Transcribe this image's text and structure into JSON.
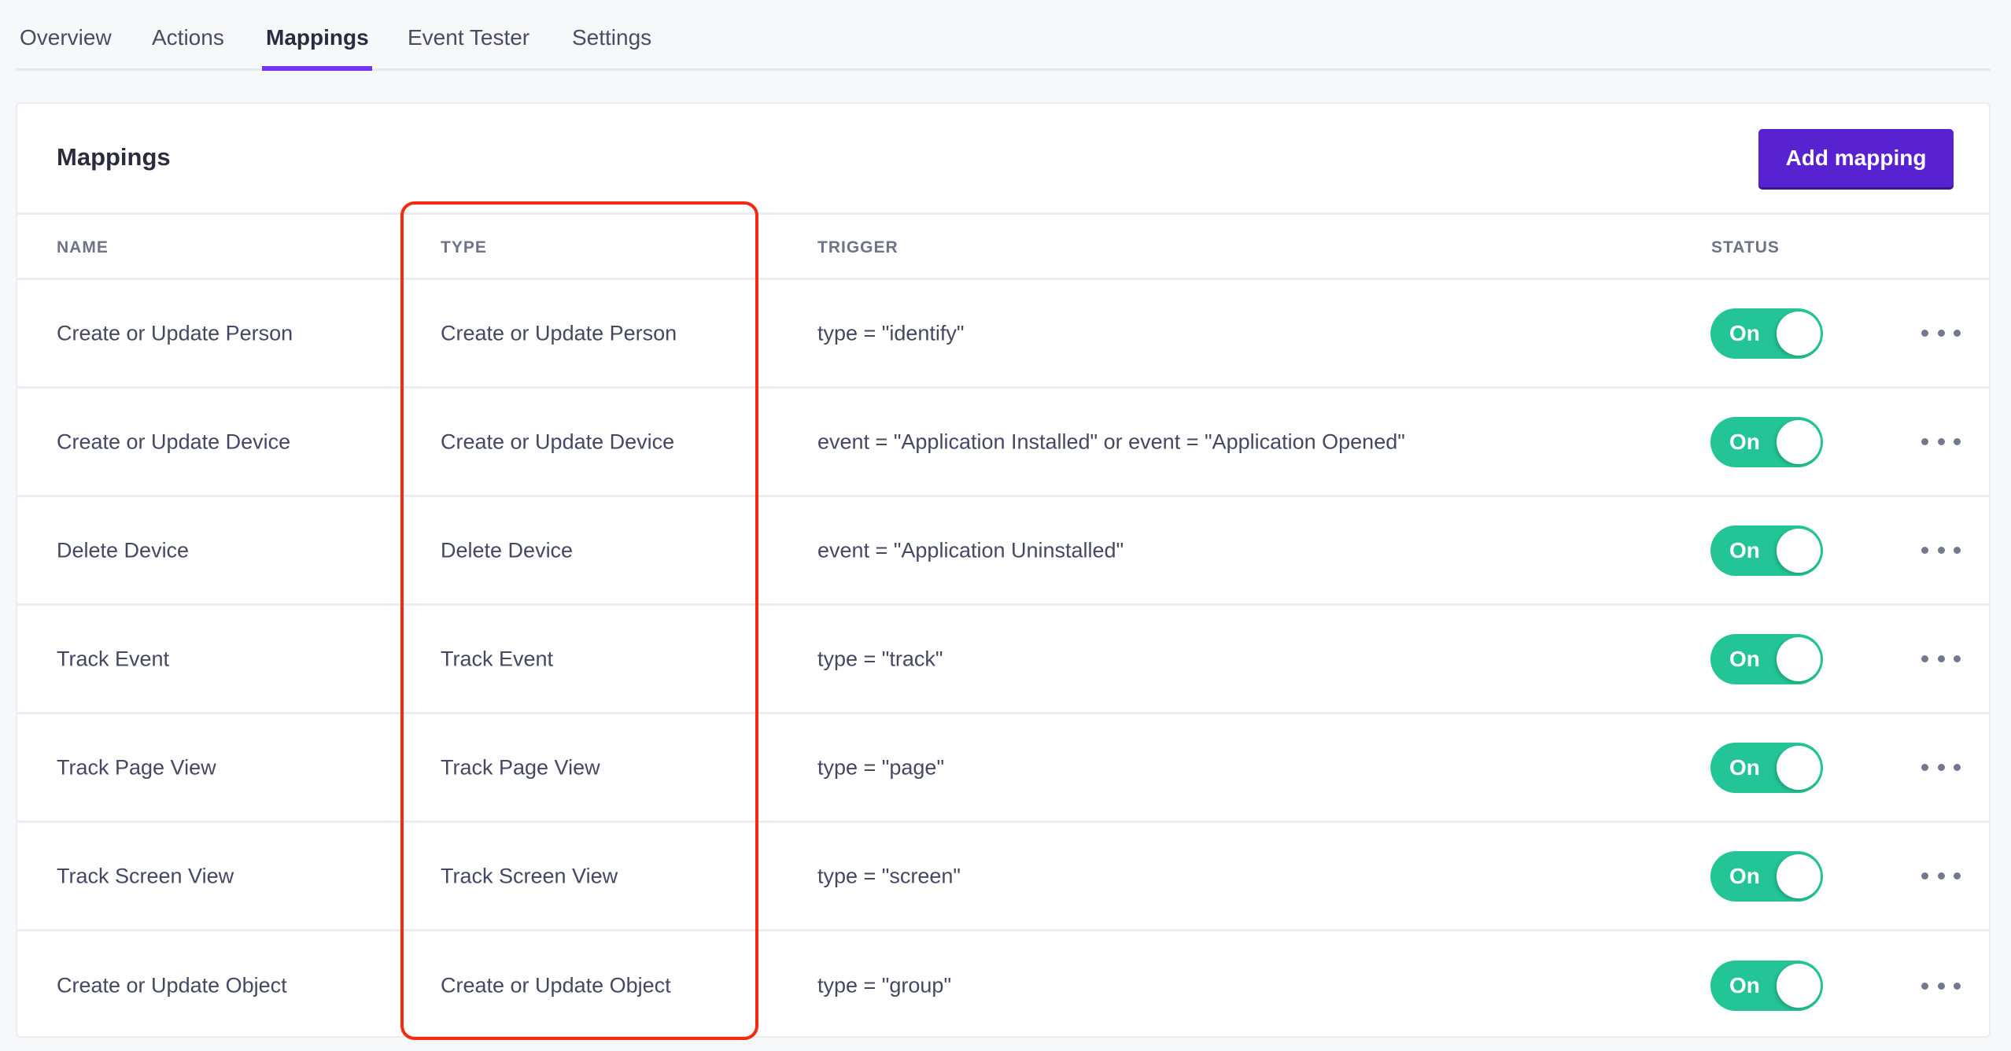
{
  "tabs": [
    {
      "label": "Overview",
      "active": false
    },
    {
      "label": "Actions",
      "active": false
    },
    {
      "label": "Mappings",
      "active": true
    },
    {
      "label": "Event Tester",
      "active": false
    },
    {
      "label": "Settings",
      "active": false
    }
  ],
  "card": {
    "title": "Mappings",
    "add_button_label": "Add mapping"
  },
  "table": {
    "columns": [
      "NAME",
      "TYPE",
      "TRIGGER",
      "STATUS"
    ],
    "rows": [
      {
        "name": "Create or Update Person",
        "type": "Create or Update Person",
        "trigger": "type = \"identify\"",
        "status": "On"
      },
      {
        "name": "Create or Update Device",
        "type": "Create or Update Device",
        "trigger": "event = \"Application Installed\" or event = \"Application Opened\"",
        "status": "On"
      },
      {
        "name": "Delete Device",
        "type": "Delete Device",
        "trigger": "event = \"Application Uninstalled\"",
        "status": "On"
      },
      {
        "name": "Track Event",
        "type": "Track Event",
        "trigger": "type = \"track\"",
        "status": "On"
      },
      {
        "name": "Track Page View",
        "type": "Track Page View",
        "trigger": "type = \"page\"",
        "status": "On"
      },
      {
        "name": "Track Screen View",
        "type": "Track Screen View",
        "trigger": "type = \"screen\"",
        "status": "On"
      },
      {
        "name": "Create or Update Object",
        "type": "Create or Update Object",
        "trigger": "type = \"group\"",
        "status": "On"
      }
    ]
  },
  "icons": {
    "row_menu": "more-horizontal-icon"
  },
  "colors": {
    "accent_tab": "#7533f5",
    "primary_button": "#5822d0",
    "toggle_on": "#23c495",
    "highlight": "#f52a0e"
  }
}
